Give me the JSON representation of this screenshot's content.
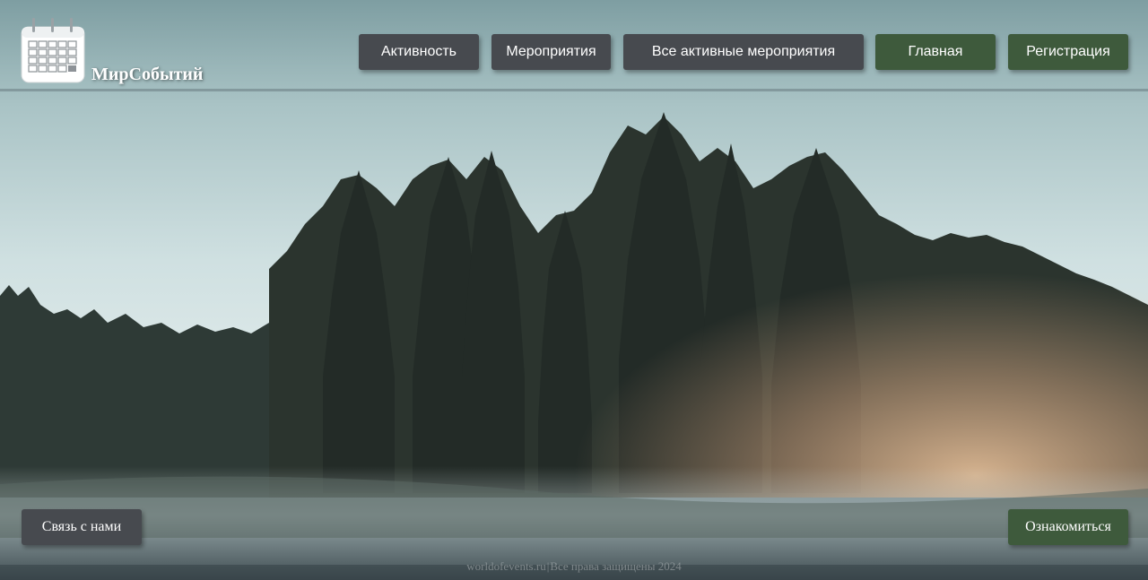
{
  "brand": {
    "name": "МирСобытий",
    "logo_icon": "calendar-icon"
  },
  "nav": {
    "activity": "Активность",
    "events": "Мероприятия",
    "all_active_events": "Все активные мероприятия",
    "home": "Главная",
    "register": "Регистрация"
  },
  "actions": {
    "contact": "Связь с нами",
    "learn_more": "Ознакомиться"
  },
  "footer": {
    "site": "worldofevents.ru",
    "separator": "|",
    "rights": "Все права защищены 2024"
  },
  "colors": {
    "nav_dark": "#474a4f",
    "nav_green": "#3e5a3c",
    "sky_top": "#7e9ea2",
    "sky_mid": "#c9dcdd"
  }
}
